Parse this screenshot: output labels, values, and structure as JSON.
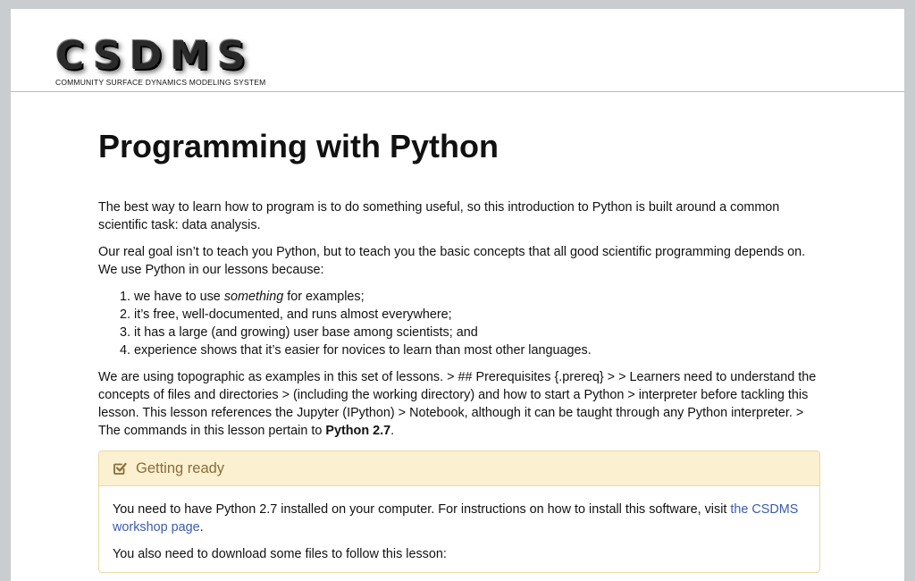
{
  "logo": {
    "text": "CSDMS",
    "subtitle": "COMMUNITY SURFACE DYNAMICS MODELING SYSTEM"
  },
  "page_title": "Programming with Python",
  "intro": {
    "p1": "The best way to learn how to program is to do something useful, so this introduction to Python is built around a common scientific task: data analysis.",
    "p2": "Our real goal isn’t to teach you Python, but to teach you the basic concepts that all good scientific programming depends on. We use Python in our lessons because:"
  },
  "reasons": {
    "item1_pre": "we have to use ",
    "item1_em": "something",
    "item1_post": " for examples;",
    "item2": "it’s free, well-documented, and runs almost everywhere;",
    "item3": "it has a large (and growing) user base among scientists; and",
    "item4": "experience shows that it’s easier for novices to learn than most other languages."
  },
  "prereq": {
    "text": "We are using topographic as examples in this set of lessons. > ## Prerequisites {.prereq} > > Learners need to understand the concepts of files and directories > (including the working directory) and how to start a Python > interpreter before tackling this lesson. This lesson references the Jupyter (IPython) > Notebook, although it can be taught through any Python interpreter. > The commands in this lesson pertain to ",
    "bold": "Python 2.7",
    "end": "."
  },
  "callout": {
    "title": "Getting ready",
    "icon": "check-square-icon",
    "accent_color": "#8a6d3b",
    "p1_pre": "You need to have Python 2.7 installed on your computer. For instructions on how to install this software, visit ",
    "p1_link": "the CSDMS workshop page",
    "p1_post": ".",
    "p2": "You also need to download some files to follow this lesson:"
  }
}
